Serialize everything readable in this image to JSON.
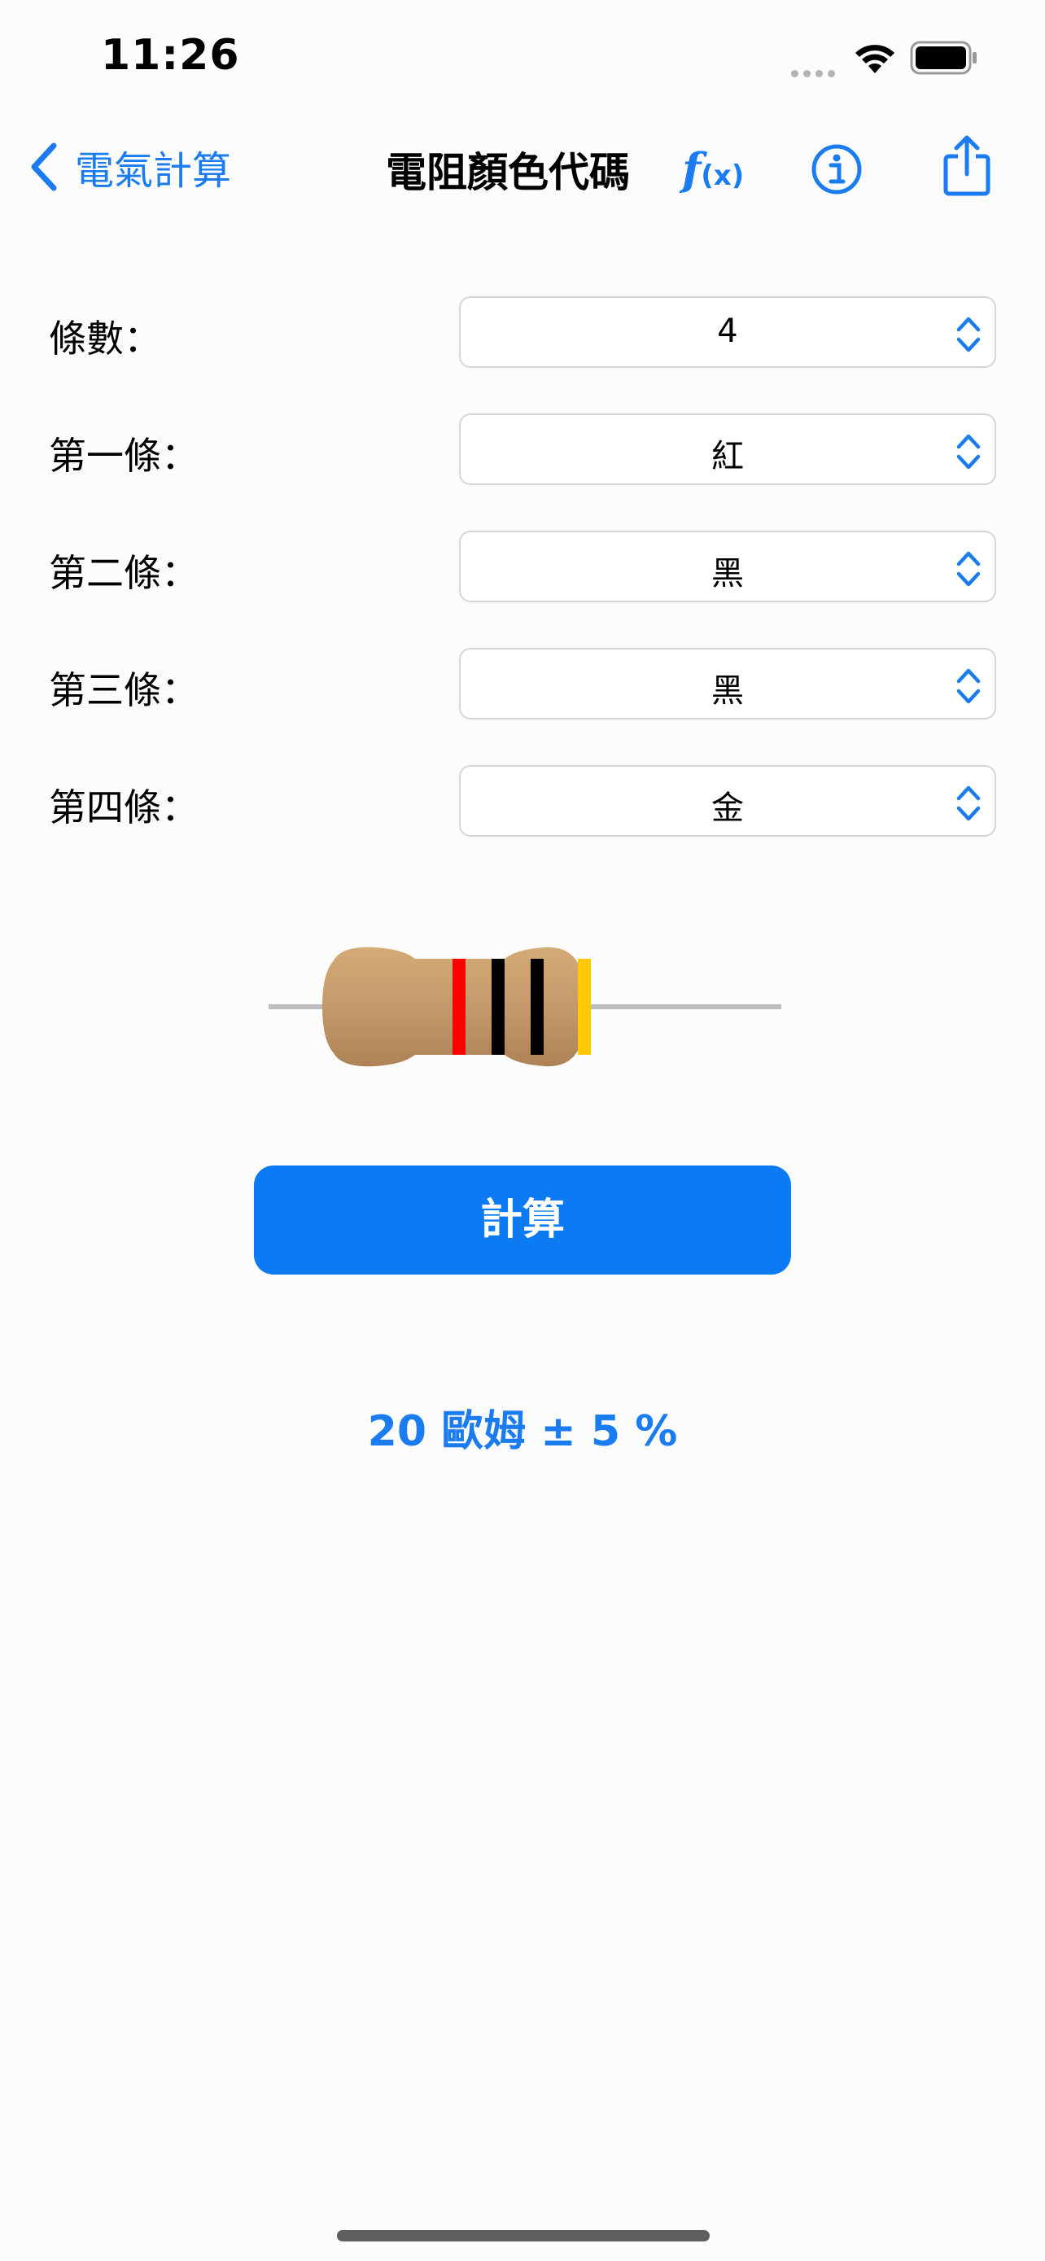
{
  "status_bar": {
    "time": "11:26"
  },
  "nav": {
    "back_label": "電氣計算",
    "title": "電阻顏色代碼",
    "formula_icon": "f(x)"
  },
  "form": {
    "rows": [
      {
        "label": "條數：",
        "value": "4"
      },
      {
        "label": "第一條：",
        "value": "紅"
      },
      {
        "label": "第二條：",
        "value": "黑"
      },
      {
        "label": "第三條：",
        "value": "黑"
      },
      {
        "label": "第四條：",
        "value": "金"
      }
    ]
  },
  "resistor": {
    "body_color": "#c49a6c",
    "band_colors": [
      "#ff0000",
      "#000000",
      "#000000",
      "#ffc800"
    ]
  },
  "calculate_label": "計算",
  "result_text": "20 歐姆 ± 5 %",
  "accent_color": "#1a7cf0"
}
